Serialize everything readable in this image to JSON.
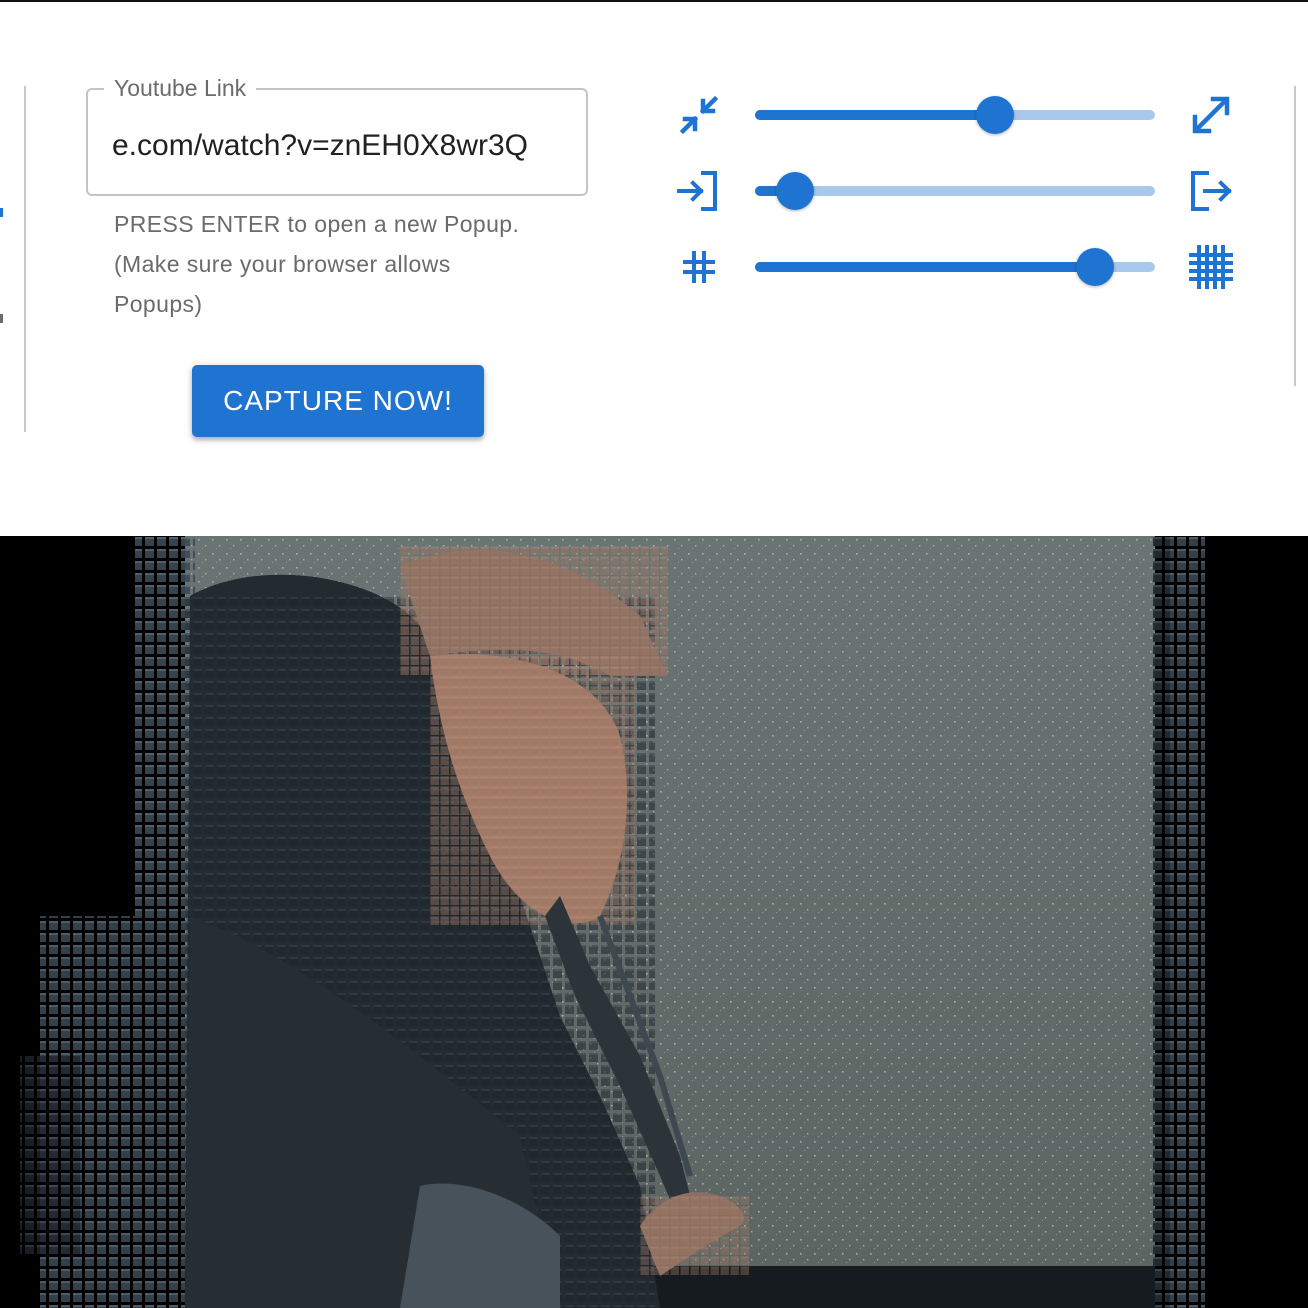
{
  "link": {
    "legend": "Youtube Link",
    "value": "e.com/watch?v=znEH0X8wr3Q"
  },
  "helper": {
    "line1": "PRESS ENTER to open a new Popup.",
    "line2": "(Make sure your browser allows",
    "line3": "Popups)"
  },
  "capture_label": "CAPTURE NOW!",
  "sliders": [
    {
      "name": "scale",
      "min_icon": "compress-arrows-icon",
      "max_icon": "expand-arrows-icon",
      "value": 0.6
    },
    {
      "name": "depth",
      "min_icon": "login-icon",
      "max_icon": "logout-icon",
      "value": 0.1
    },
    {
      "name": "density",
      "min_icon": "small-grid-icon",
      "max_icon": "large-grid-icon",
      "value": 0.85
    }
  ],
  "colors": {
    "accent": "#1f74d2",
    "rail": "#a8c9ec",
    "video_background": "#000000"
  },
  "video": {
    "description_icon": "pixelated-video-render"
  }
}
